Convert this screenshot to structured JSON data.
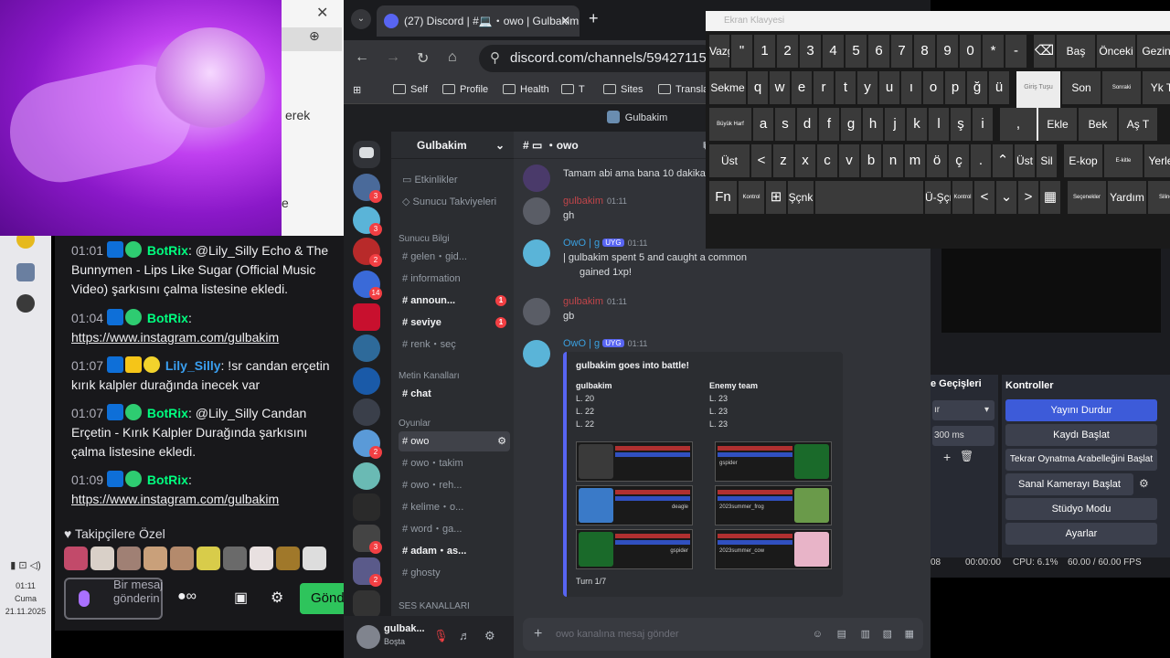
{
  "taskbar": {
    "time": "01:11",
    "day": "Cuma",
    "date": "21.11.2025"
  },
  "webcam": {
    "label": ""
  },
  "back_window": {
    "text1": "erek",
    "text2": "e"
  },
  "chat": {
    "messages": [
      {
        "time": "01:01",
        "user": "BotRix",
        "text": ": @Lily_Silly Echo & The Bunnymen - Lips Like Sugar (Official Music Video) şarkısını çalma listesine ekledi."
      },
      {
        "time": "01:04",
        "user": "BotRix",
        "text": ":",
        "link": "https://www.instagram.com/gulbakim"
      },
      {
        "time": "01:07",
        "user": "Lily_Silly",
        "text": ": !sr candan erçetin kırık kalpler durağında inecek var"
      },
      {
        "time": "01:07",
        "user": "BotRix",
        "text": ": @Lily_Silly Candan Erçetin - Kırık Kalpler Durağında şarkısını çalma listesine ekledi."
      },
      {
        "time": "01:09",
        "user": "BotRix",
        "text": ":",
        "link": "https://www.instagram.com/gulbakim"
      }
    ],
    "subs_header": "Takipçilere Özel",
    "input_placeholder": "Bir mesaj gönderin",
    "send_label": "Gönd"
  },
  "chrome": {
    "tab_title": "(27) Discord | #💻・owo | Gulbakim",
    "tab_badge": "27",
    "url": "discord.com/channels/5942711511...",
    "bookmarks": [
      "Self",
      "Profile",
      "Health",
      "T",
      "Sites",
      "Translatio"
    ]
  },
  "discord": {
    "window_title": "Gulbakim",
    "server_name": "Gulbakim",
    "channel_header": "・owo",
    "categories": [
      "Sunucu Bilgi",
      "Metin Kanalları",
      "Oyunlar",
      "SES KANALLARI"
    ],
    "channels_top": [
      "Etkinlikler",
      "Sunucu Takviyeleri"
    ],
    "channels_info": [
      {
        "name": "gelen・gid...",
        "badge": ""
      },
      {
        "name": "information",
        "badge": ""
      },
      {
        "name": "announ...",
        "badge": "1"
      },
      {
        "name": "seviye",
        "badge": "1"
      },
      {
        "name": "renk・seç",
        "badge": ""
      }
    ],
    "channels_text": [
      "chat"
    ],
    "channels_games": [
      "owo",
      "owo・takim",
      "owo・reh...",
      "kelime・o...",
      "word・ga...",
      "adam・as...",
      "ghosty"
    ],
    "server_badges": [
      "3",
      "3",
      "2",
      "14",
      "2",
      "3",
      "2"
    ],
    "user": {
      "name": "gulbak...",
      "status": "Boşta"
    },
    "messages": [
      {
        "user": "",
        "time": "",
        "text": "Tamam abi ama bana 10 dakika ve"
      },
      {
        "user": "gulbakim",
        "time": "01:11",
        "text": "gh"
      },
      {
        "user": "OwO | g",
        "tag": "UYG",
        "time": "01:11",
        "text": "| gulbakim spent 5 and caught a common",
        "text2": "gained 1xp!"
      },
      {
        "user": "gulbakim",
        "time": "01:11",
        "text": "gb"
      },
      {
        "user": "OwO | g",
        "tag": "UYG",
        "time": "01:11",
        "text": ""
      }
    ],
    "battle": {
      "title": "gulbakim goes into battle!",
      "team1": "gulbakim",
      "team2": "Enemy team",
      "levels1": [
        "L. 20",
        "L. 22",
        "L. 22"
      ],
      "levels2": [
        "L. 23",
        "L. 23",
        "L. 23"
      ],
      "cards": [
        "",
        "gspider",
        "deagle",
        "2023summer_frog",
        "gspider",
        "2023summer_cow"
      ],
      "turn": "Turn 1/7"
    },
    "input_placeholder": "owo kanalına mesaj gönder"
  },
  "keyboard": {
    "title": "Ekran Klavyesi",
    "row1": [
      "Vazgeç",
      "\"",
      "1",
      "2",
      "3",
      "4",
      "5",
      "6",
      "7",
      "8",
      "9",
      "0",
      "*",
      "-",
      "⌫",
      "Baş",
      "Önceki",
      "Gezin"
    ],
    "row2": [
      "Sekme",
      "q",
      "w",
      "e",
      "r",
      "t",
      "y",
      "u",
      "ı",
      "o",
      "p",
      "ğ",
      "ü",
      "Giriş Tuşu",
      "Son",
      "Sonraki",
      "Yk T"
    ],
    "row3": [
      "Büyük Harf",
      "a",
      "s",
      "d",
      "f",
      "g",
      "h",
      "j",
      "k",
      "l",
      "ş",
      "i",
      ",",
      "Ekle",
      "Bek",
      "Aş T"
    ],
    "row4": [
      "Üst",
      "<",
      "z",
      "x",
      "c",
      "v",
      "b",
      "n",
      "m",
      "ö",
      "ç",
      ".",
      "⌃",
      "Üst",
      "Sil",
      "E-kop",
      "E-kitle",
      "Yerleş"
    ],
    "row5": [
      "Fn",
      "Kontrol",
      "⊞",
      "Şçnk",
      "",
      "Ü-Şçnk",
      "Kontrol",
      "<",
      "⌄",
      ">",
      "▦",
      "Seçenekler",
      "Yardım",
      "Silinen"
    ]
  },
  "obs": {
    "transitions_label": "e Geçişleri",
    "controls_label": "Kontroller",
    "duration": "300 ms",
    "buttons": [
      "Yayını Durdur",
      "Kaydı Başlat",
      "Tekrar Oynatma Arabelleğini Başlat",
      "Sanal Kamerayı Başlat",
      "Stüdyo Modu",
      "Ayarlar"
    ],
    "status_time": "00:00:00",
    "cpu": "CPU: 6.1%",
    "fps": "60.00 / 60.00 FPS",
    "misc": "08"
  }
}
